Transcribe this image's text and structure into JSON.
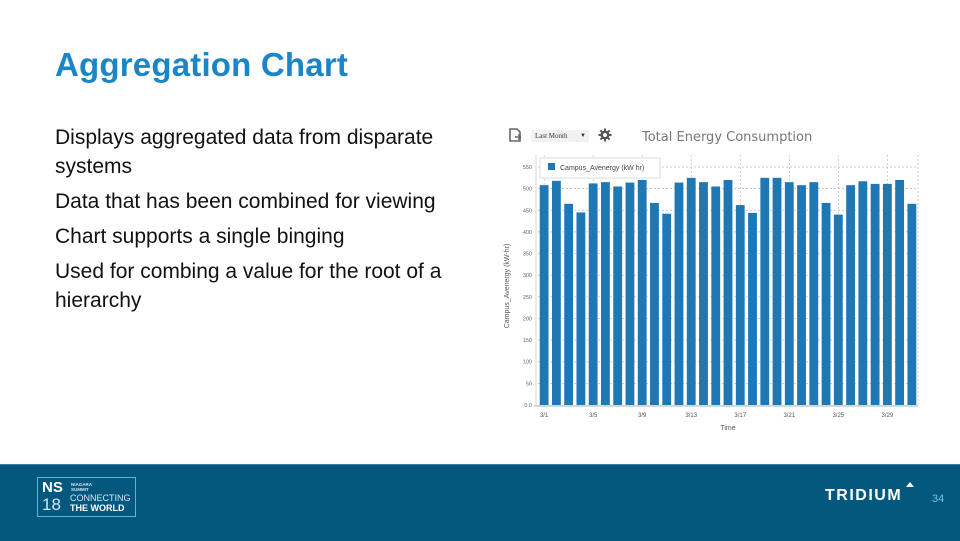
{
  "slide": {
    "title": "Aggregation Chart",
    "bullets": [
      "Displays aggregated data from disparate systems",
      "Data that has been combined for viewing",
      "Chart supports a single binging",
      "Used for combing a value for the root of a hierarchy"
    ],
    "page_number": "34"
  },
  "chart_toolbar": {
    "range_selected": "Last Month",
    "export_icon": "export-icon",
    "settings_icon": "gear-icon"
  },
  "footer": {
    "event_logo": {
      "ns": "NS",
      "year": "18",
      "line1": "NIAGARA",
      "line2": "SUMMIT",
      "tagline1": "CONNECTING",
      "tagline2": "THE WORLD"
    },
    "brand": "TRIDIUM"
  },
  "colors": {
    "title": "#1a86c8",
    "bar": "#1f77b4",
    "footer_bg": "#04577d",
    "page_number": "#6fc3ea"
  },
  "chart_data": {
    "type": "bar",
    "title": "Total Energy Consumption",
    "xlabel": "Time",
    "ylabel": "Campus_Avenergy (kW-hr)",
    "legend": [
      "Campus_Avenergy (kW hr)"
    ],
    "legend_position": "top-left",
    "grid": true,
    "ylim": [
      0,
      550
    ],
    "yticks": [
      "0.0",
      "50",
      "100",
      "150",
      "200",
      "250",
      "300",
      "350",
      "400",
      "450",
      "500",
      "550"
    ],
    "xtick_labels": [
      "3/1",
      "3/5",
      "3/9",
      "3/13",
      "3/17",
      "3/21",
      "3/25",
      "3/29"
    ],
    "categories": [
      "3/1",
      "3/2",
      "3/3",
      "3/4",
      "3/5",
      "3/6",
      "3/7",
      "3/8",
      "3/9",
      "3/10",
      "3/11",
      "3/12",
      "3/13",
      "3/14",
      "3/15",
      "3/16",
      "3/17",
      "3/18",
      "3/19",
      "3/20",
      "3/21",
      "3/22",
      "3/23",
      "3/24",
      "3/25",
      "3/26",
      "3/27",
      "3/28",
      "3/29",
      "3/30",
      "3/31"
    ],
    "series": [
      {
        "name": "Campus_Avenergy (kW hr)",
        "values": [
          508,
          518,
          465,
          445,
          512,
          515,
          505,
          514,
          520,
          467,
          442,
          514,
          525,
          515,
          505,
          520,
          462,
          444,
          525,
          525,
          515,
          508,
          515,
          467,
          440,
          508,
          517,
          511,
          511,
          520,
          465
        ]
      }
    ]
  }
}
